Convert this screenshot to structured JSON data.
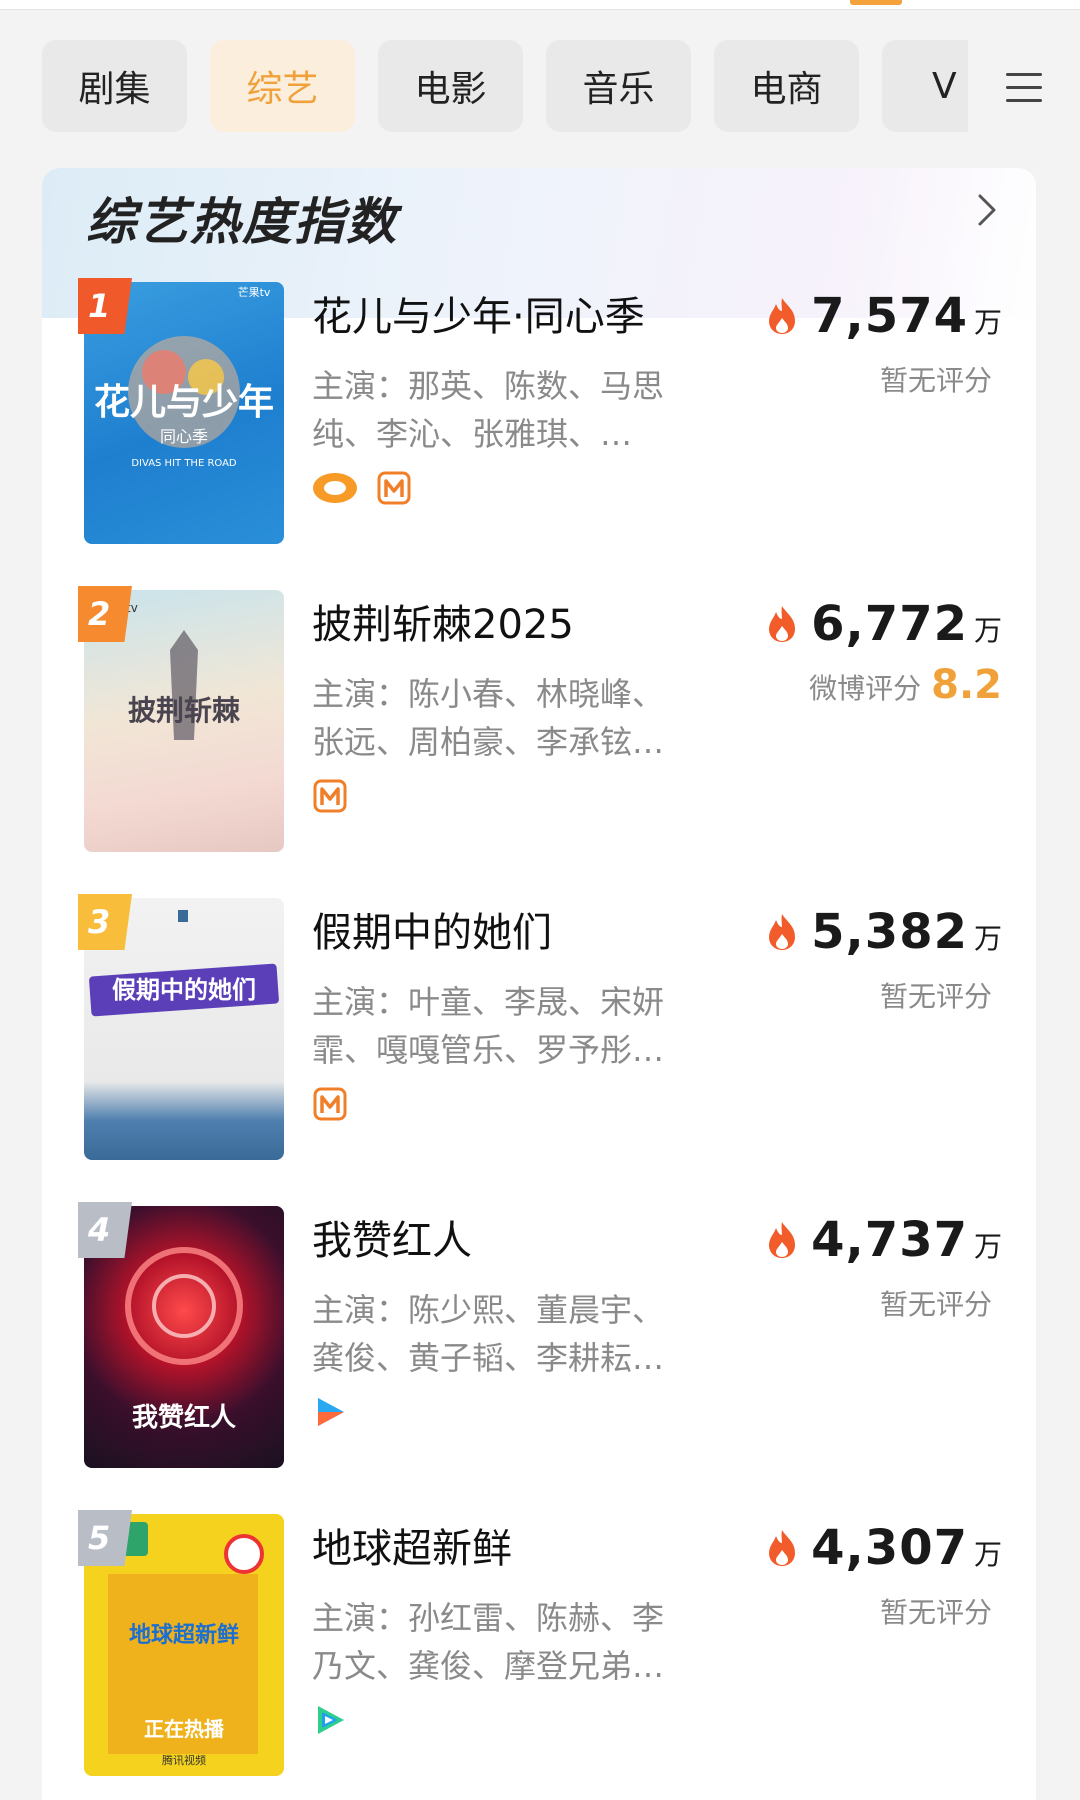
{
  "tabs": [
    {
      "label": "剧集",
      "active": false
    },
    {
      "label": "综艺",
      "active": true
    },
    {
      "label": "电影",
      "active": false
    },
    {
      "label": "音乐",
      "active": false
    },
    {
      "label": "电商",
      "active": false
    },
    {
      "label": "V",
      "active": false
    }
  ],
  "panel": {
    "title": "综艺热度指数",
    "more_icon": "chevron-right-icon"
  },
  "heat_unit": "万",
  "items": [
    {
      "rank": "1",
      "title": "花儿与少年·同心季",
      "cast_line1": "主演：那英、陈数、马思",
      "cast_line2": "纯、李沁、张雅琪、…",
      "heat": "7,574",
      "score_text": "暂无评分",
      "score_value": "",
      "platforms": [
        "mango-tv-icon",
        "mgtv-icon"
      ],
      "poster_text": "花儿与少年",
      "poster_sub": "同心季",
      "poster_en": "DIVAS HIT THE ROAD",
      "poster_logo": "芒果tv"
    },
    {
      "rank": "2",
      "title": "披荆斩棘2025",
      "cast_line1": "主演：陈小春、林晓峰、",
      "cast_line2": "张远、周柏豪、李承铉…",
      "heat": "6,772",
      "score_text": "微博评分",
      "score_value": "8.2",
      "platforms": [
        "mgtv-icon"
      ],
      "poster_text": "披荆斩棘",
      "poster_logo": "果tv"
    },
    {
      "rank": "3",
      "title": "假期中的她们",
      "cast_line1": "主演：叶童、李晟、宋妍",
      "cast_line2": "霏、嘎嘎管乐、罗予彤…",
      "heat": "5,382",
      "score_text": "暂无评分",
      "score_value": "",
      "platforms": [
        "mgtv-icon"
      ],
      "poster_text": "假期中的她们"
    },
    {
      "rank": "4",
      "title": "我赞红人",
      "cast_line1": "主演：陈少熙、董晨宇、",
      "cast_line2": "龚俊、黄子韬、李耕耘…",
      "heat": "4,737",
      "score_text": "暂无评分",
      "score_value": "",
      "platforms": [
        "youku-icon"
      ],
      "poster_text": "我赞红人"
    },
    {
      "rank": "5",
      "title": "地球超新鲜",
      "cast_line1": "主演：孙红雷、陈赫、李",
      "cast_line2": "乃文、龚俊、摩登兄弟…",
      "heat": "4,307",
      "score_text": "暂无评分",
      "score_value": "",
      "platforms": [
        "tencent-video-icon"
      ],
      "poster_text": "地球超新鲜",
      "poster_sub": "正在热播",
      "poster_logo": "腾讯视频"
    }
  ],
  "colors": {
    "accent": "#f0a13a",
    "rank1": "#f05a2a",
    "rank2": "#f58a2e",
    "rank3": "#f8bd3a",
    "rank_other": "#b9bec6",
    "muted": "#8a8a8a"
  }
}
